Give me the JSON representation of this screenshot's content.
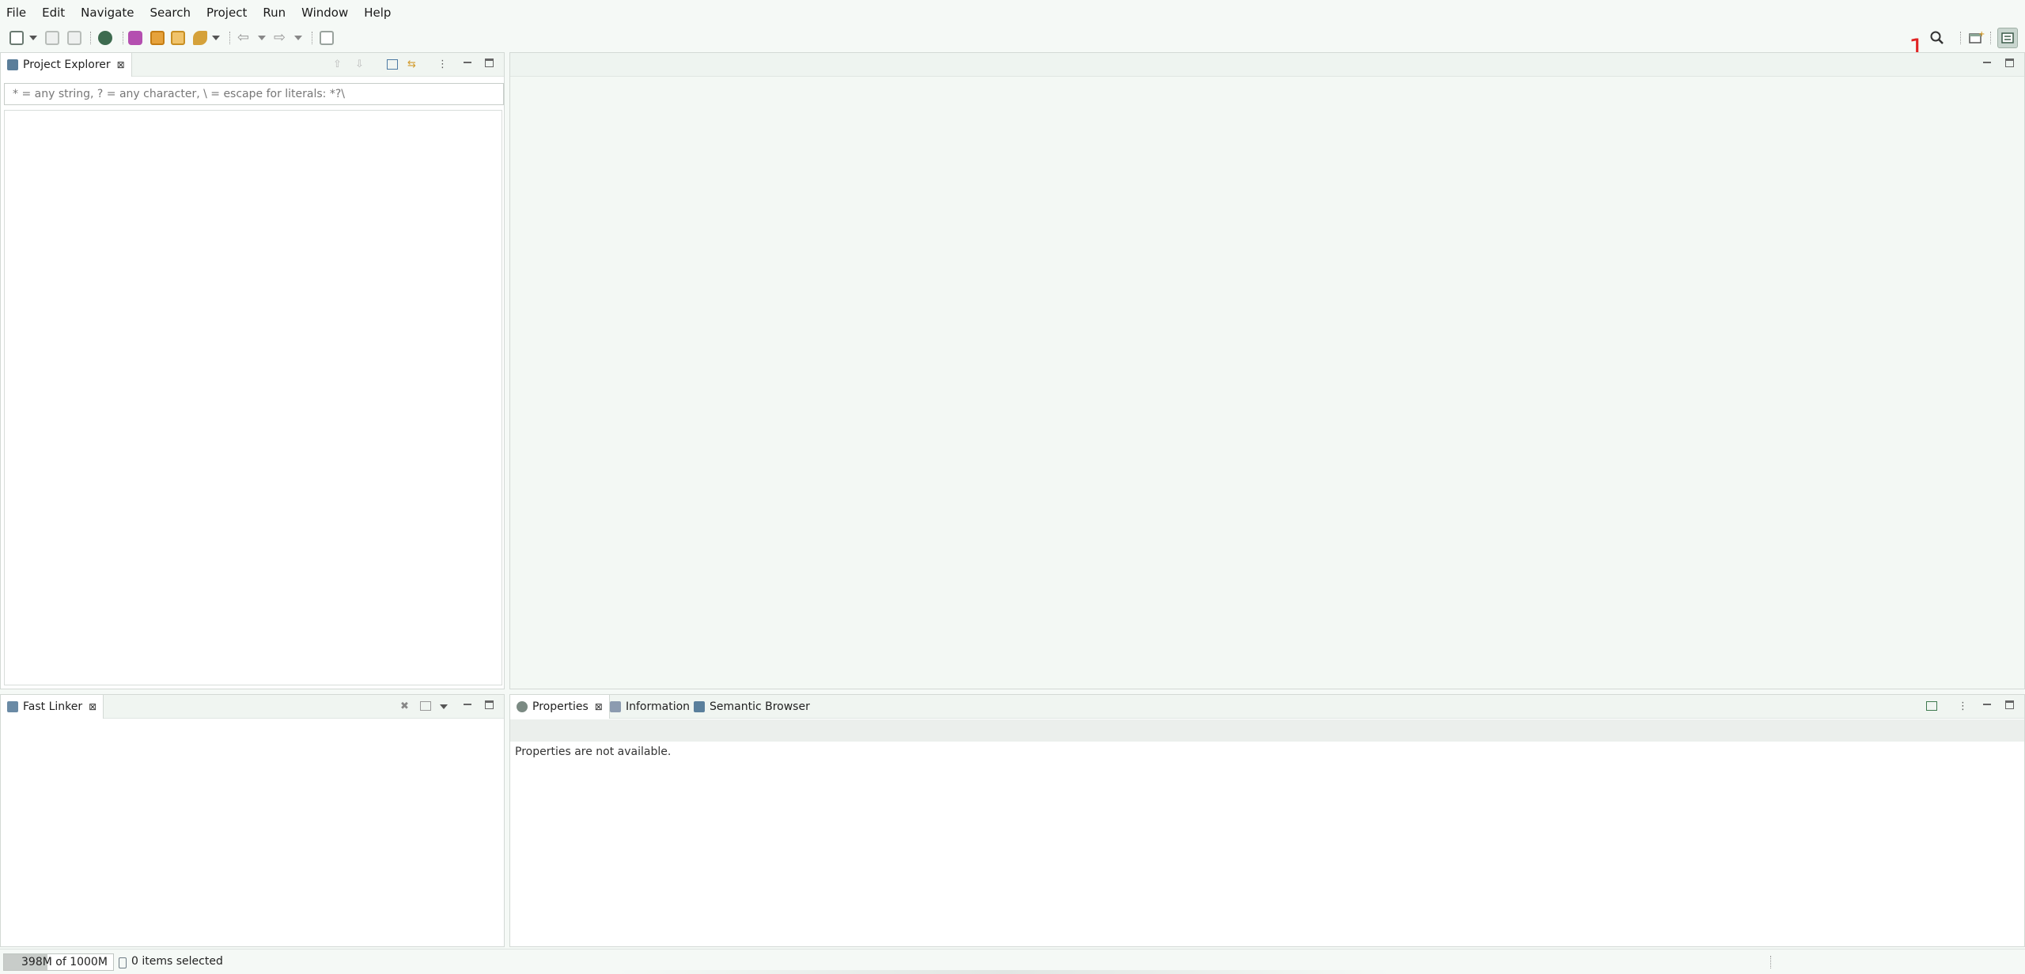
{
  "menu": [
    "File",
    "Edit",
    "Navigate",
    "Search",
    "Project",
    "Run",
    "Window",
    "Help"
  ],
  "overlay_label": "1",
  "project_explorer": {
    "tab_label": "Project Explorer",
    "filter_placeholder": "* = any string, ? = any character, \\ = escape for literals: *?\\"
  },
  "fast_linker": {
    "tab_label": "Fast Linker"
  },
  "bottom_panel": {
    "tabs": [
      "Properties",
      "Information",
      "Semantic Browser"
    ],
    "message": "Properties are not available."
  },
  "status": {
    "heap_text": "398M of 1000M",
    "heap_used_fraction": 0.398,
    "selection_text": "0 items selected"
  },
  "icons": {
    "search": "search-icon",
    "perspective": "open-perspective-icon",
    "active_perspective": "modeling-perspective-icon"
  },
  "colors": {
    "background": "#f5f9f6",
    "overlay_number": "#e02424",
    "active_perspective_bg": "#c9d6cf"
  }
}
